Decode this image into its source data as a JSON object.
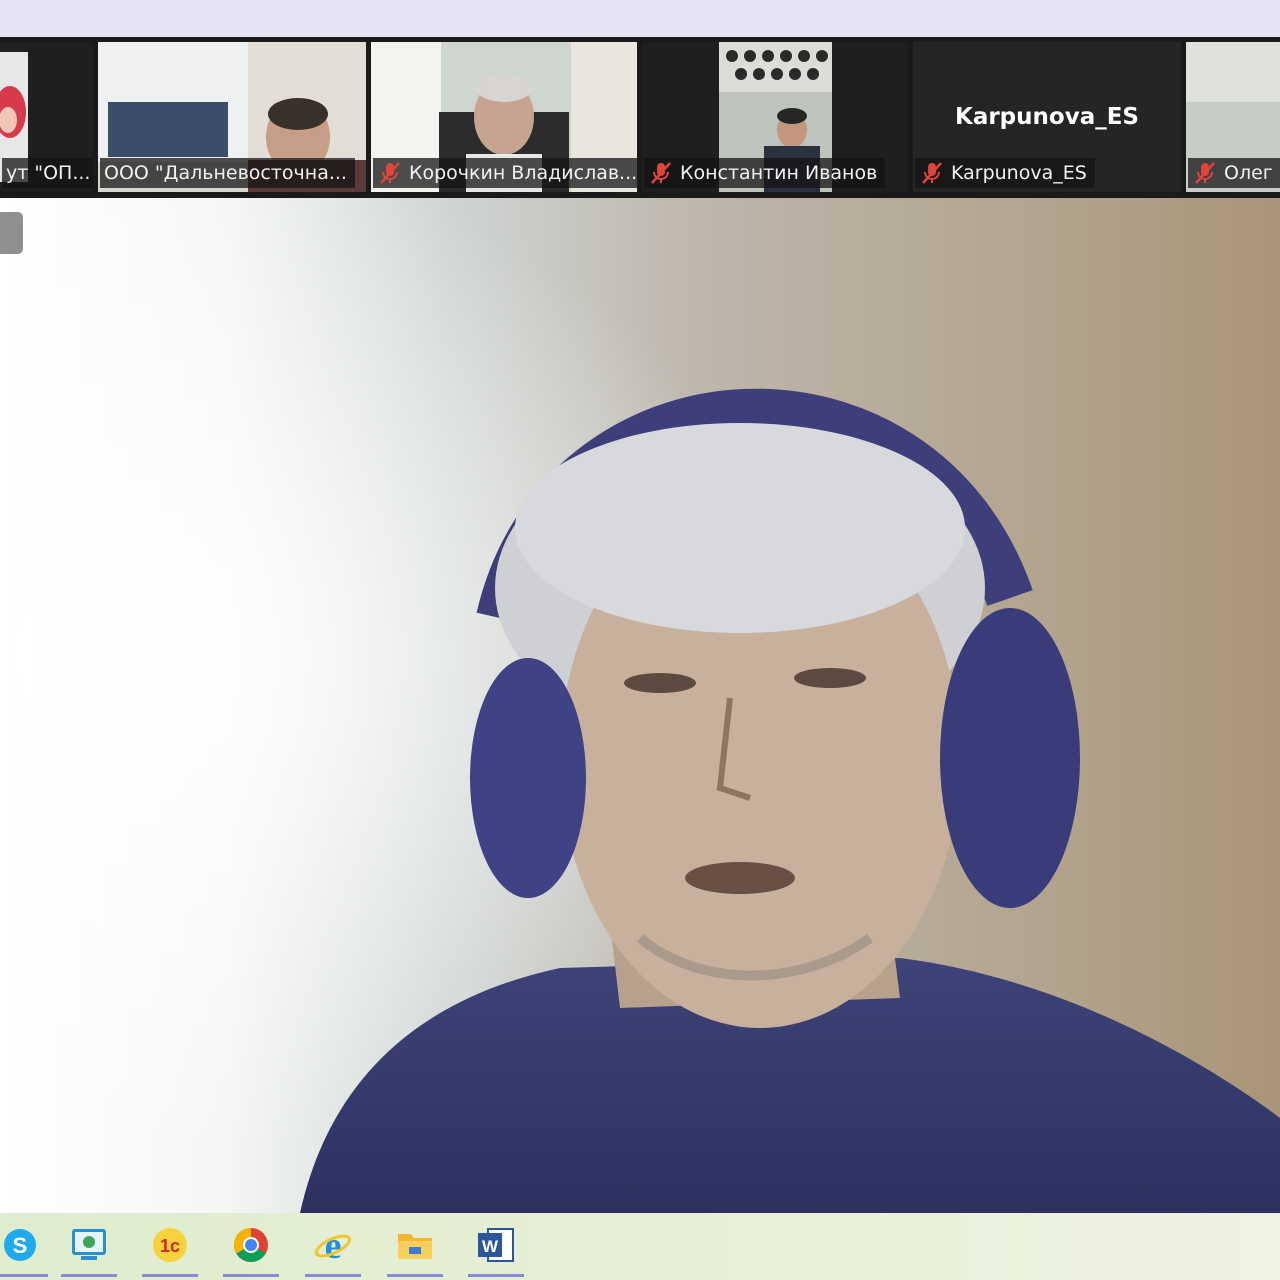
{
  "participants": [
    {
      "name": "ут \"ОП...",
      "muted": false
    },
    {
      "name": "ООО \"Дальневосточна...",
      "muted": false
    },
    {
      "name": "Корочкин Владислав...",
      "muted": true
    },
    {
      "name": "Константин Иванов",
      "muted": true
    },
    {
      "name": "Karpunova_ES",
      "muted": true,
      "display_name": "Karpunova_ES"
    },
    {
      "name": "Олег",
      "muted": true
    }
  ],
  "taskbar": {
    "apps": [
      {
        "icon": "skype-icon"
      },
      {
        "icon": "remote-desktop-icon"
      },
      {
        "icon": "1c-icon",
        "label": "1c"
      },
      {
        "icon": "chrome-icon"
      },
      {
        "icon": "internet-explorer-icon"
      },
      {
        "icon": "file-explorer-icon"
      },
      {
        "icon": "word-icon",
        "label": "W"
      }
    ]
  },
  "colors": {
    "top_strip": "#e8e2f5",
    "thumb_bar": "#1a1a1a",
    "muted_mic": "#e0443a",
    "taskbar": "#e3eed3",
    "taskbar_indicator": "#8a8ad8"
  }
}
